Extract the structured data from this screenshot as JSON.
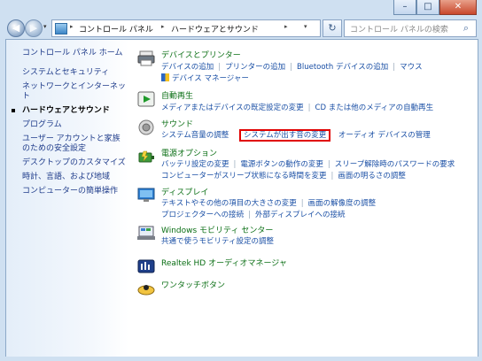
{
  "window": {
    "min_glyph": "–",
    "max_glyph": "□",
    "close_glyph": "✕"
  },
  "nav": {
    "back_glyph": "◀",
    "forward_glyph": "▶",
    "dropdown_glyph": "▾",
    "breadcrumb": [
      "コントロール パネル",
      "ハードウェアとサウンド"
    ],
    "separator": "▸",
    "refresh_glyph": "↻",
    "search_placeholder": "コントロール パネルの検索",
    "search_glyph": "⌕"
  },
  "sidebar": {
    "items": [
      {
        "label": "コントロール パネル ホーム",
        "current": false
      },
      {
        "label": "システムとセキュリティ",
        "current": false
      },
      {
        "label": "ネットワークとインターネット",
        "current": false
      },
      {
        "label": "ハードウェアとサウンド",
        "current": true
      },
      {
        "label": "プログラム",
        "current": false
      },
      {
        "label": "ユーザー アカウントと家族のための安全設定",
        "current": false
      },
      {
        "label": "デスクトップのカスタマイズ",
        "current": false
      },
      {
        "label": "時計、言語、および地域",
        "current": false
      },
      {
        "label": "コンピューターの簡単操作",
        "current": false
      }
    ]
  },
  "categories": [
    {
      "title": "デバイスとプリンター",
      "icon": "printer-icon",
      "rows": [
        [
          "デバイスの追加",
          "プリンターの追加",
          "Bluetooth デバイスの追加",
          "マウス"
        ],
        [
          "デバイス マネージャー"
        ]
      ]
    },
    {
      "title": "自動再生",
      "icon": "autoplay-icon",
      "rows": [
        [
          "メディアまたはデバイスの既定設定の変更",
          "CD または他のメディアの自動再生"
        ]
      ]
    },
    {
      "title": "サウンド",
      "icon": "speaker-icon",
      "rows": [
        [
          "システム音量の調整",
          "システムが出す音の変更",
          "オーディオ デバイスの管理"
        ]
      ]
    },
    {
      "title": "電源オプション",
      "icon": "power-icon",
      "rows": [
        [
          "バッテリ設定の変更",
          "電源ボタンの動作の変更",
          "スリープ解除時のパスワードの要求"
        ],
        [
          "コンピューターがスリープ状態になる時間を変更",
          "画面の明るさの調整"
        ]
      ]
    },
    {
      "title": "ディスプレイ",
      "icon": "display-icon",
      "rows": [
        [
          "テキストやその他の項目の大きさの変更",
          "画面の解像度の調整"
        ],
        [
          "プロジェクターへの接続",
          "外部ディスプレイへの接続"
        ]
      ]
    },
    {
      "title": "Windows モビリティ センター",
      "icon": "mobility-icon",
      "rows": [
        [
          "共通で使うモビリティ設定の調整"
        ]
      ]
    },
    {
      "title": "Realtek HD オーディオマネージャ",
      "icon": "realtek-icon",
      "rows": []
    },
    {
      "title": "ワンタッチボタン",
      "icon": "onetouch-icon",
      "rows": []
    }
  ],
  "highlighted_link": "システムが出す音の変更",
  "colors": {
    "link": "#1a4fa5",
    "heading": "#0b6f15",
    "highlight": "#e00000",
    "frame": "#cfe0f1"
  }
}
